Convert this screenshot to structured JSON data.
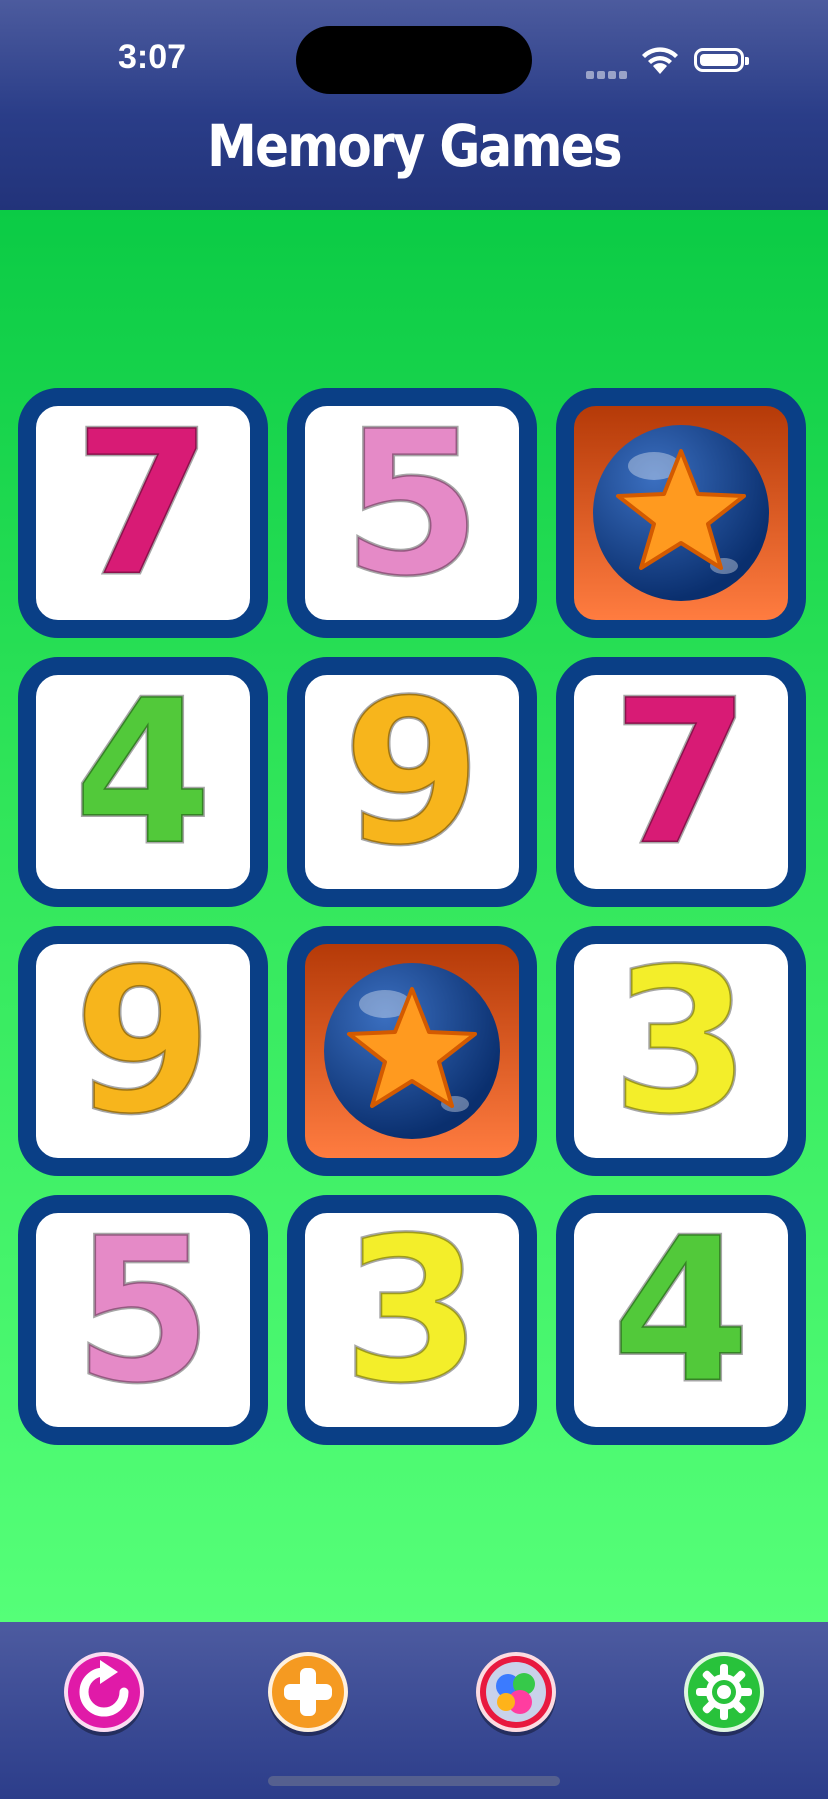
{
  "status_bar": {
    "time": "3:07"
  },
  "header": {
    "title": "Memory Games"
  },
  "board": {
    "cards": [
      {
        "face": "7",
        "color": "#d81b75"
      },
      {
        "face": "5",
        "color": "#e58ac7"
      },
      {
        "face": "star",
        "color": "#ff9a1f"
      },
      {
        "face": "4",
        "color": "#52c93a"
      },
      {
        "face": "9",
        "color": "#f7b51c"
      },
      {
        "face": "7",
        "color": "#d81b75"
      },
      {
        "face": "9",
        "color": "#f7b51c"
      },
      {
        "face": "star",
        "color": "#ff9a1f"
      },
      {
        "face": "3",
        "color": "#f3ee2a"
      },
      {
        "face": "5",
        "color": "#e58ac7"
      },
      {
        "face": "3",
        "color": "#f3ee2a"
      },
      {
        "face": "4",
        "color": "#52c93a"
      }
    ]
  },
  "toolbar": {
    "buttons": [
      {
        "name": "restart-button",
        "icon": "refresh-icon",
        "color": "#e01aa8"
      },
      {
        "name": "add-button",
        "icon": "plus-icon",
        "color": "#f59a21"
      },
      {
        "name": "themes-button",
        "icon": "color-balls-icon",
        "color": "#e8193f"
      },
      {
        "name": "settings-button",
        "icon": "gear-icon",
        "color": "#28c23b"
      }
    ]
  },
  "colors": {
    "header": "#2a3d88",
    "board_top": "#0bcb45",
    "board_bottom": "#55ff78",
    "card_border": "#0a3f86"
  }
}
